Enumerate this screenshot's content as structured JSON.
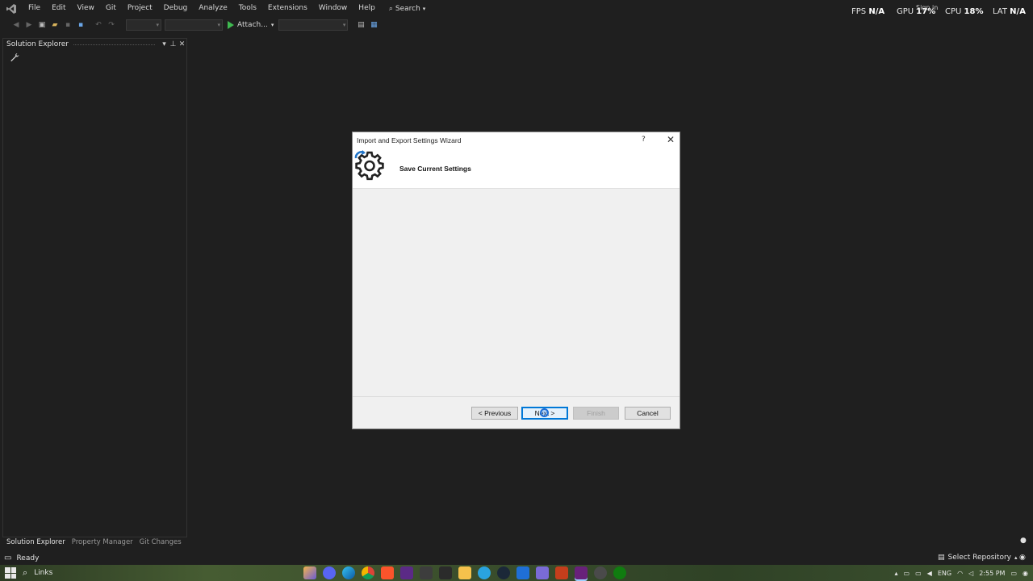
{
  "menu": {
    "items": [
      "File",
      "Edit",
      "View",
      "Git",
      "Project",
      "Debug",
      "Analyze",
      "Tools",
      "Extensions",
      "Window",
      "Help"
    ],
    "search_label": "Search"
  },
  "overlay": {
    "fps_label": "FPS",
    "fps_value": "N/A",
    "gpu_label": "GPU",
    "gpu_value": "17%",
    "cpu_label": "CPU",
    "cpu_value": "18%",
    "lat_label": "LAT",
    "lat_value": "N/A"
  },
  "signin_label": "Sign in",
  "toolbar": {
    "attach_label": "Attach..."
  },
  "solution_explorer": {
    "title": "Solution Explorer"
  },
  "bottom_tabs": [
    "Solution Explorer",
    "Property Manager",
    "Git Changes"
  ],
  "status": {
    "ready": "Ready",
    "repo": "Select Repository"
  },
  "dialog": {
    "title": "Import and Export Settings Wizard",
    "help": "?",
    "heading": "Save Current Settings",
    "buttons": {
      "previous": "< Previous",
      "next": "Next >",
      "finish": "Finish",
      "cancel": "Cancel"
    }
  },
  "taskbar": {
    "search_label": "Links",
    "tray_lang": "ENG",
    "time": "2:55 PM"
  },
  "colors": {
    "accent": "#0078d7",
    "ide_bg": "#1f1f1f",
    "dialog_bg": "#f0f0f0",
    "run_green": "#3fb950"
  }
}
